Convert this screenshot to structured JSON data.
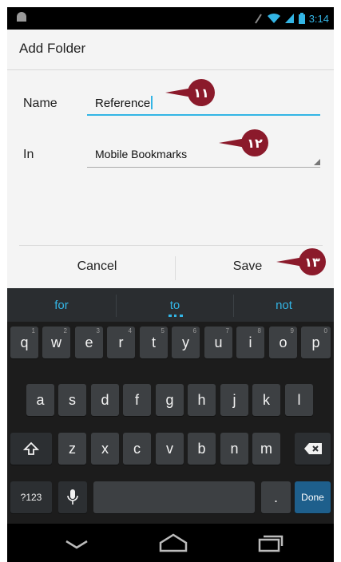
{
  "status_bar": {
    "time": "3:14",
    "icons": [
      "android-debug-icon",
      "signal-icon",
      "wifi-icon",
      "battery-icon"
    ]
  },
  "dialog": {
    "title": "Add Folder",
    "name_label": "Name",
    "name_value": "Reference",
    "in_label": "In",
    "in_value": "Mobile Bookmarks",
    "cancel_label": "Cancel",
    "save_label": "Save"
  },
  "callouts": [
    "١١",
    "١٢",
    "١٣"
  ],
  "keyboard": {
    "suggestions": [
      "for",
      "to",
      "not"
    ],
    "row1": [
      {
        "key": "q",
        "hint": "1"
      },
      {
        "key": "w",
        "hint": "2"
      },
      {
        "key": "e",
        "hint": "3"
      },
      {
        "key": "r",
        "hint": "4"
      },
      {
        "key": "t",
        "hint": "5"
      },
      {
        "key": "y",
        "hint": "6"
      },
      {
        "key": "u",
        "hint": "7"
      },
      {
        "key": "i",
        "hint": "8"
      },
      {
        "key": "o",
        "hint": "9"
      },
      {
        "key": "p",
        "hint": "0"
      }
    ],
    "row2": [
      "a",
      "s",
      "d",
      "f",
      "g",
      "h",
      "j",
      "k",
      "l"
    ],
    "row3": [
      "z",
      "x",
      "c",
      "v",
      "b",
      "n",
      "m"
    ],
    "symbols_label": "?123",
    "period_label": ".",
    "done_label": "Done"
  },
  "colors": {
    "accent": "#33b5e5",
    "callout": "#8b1a2b",
    "keyboard_bg": "#1c1c1c",
    "key_bg": "#3d4043"
  }
}
